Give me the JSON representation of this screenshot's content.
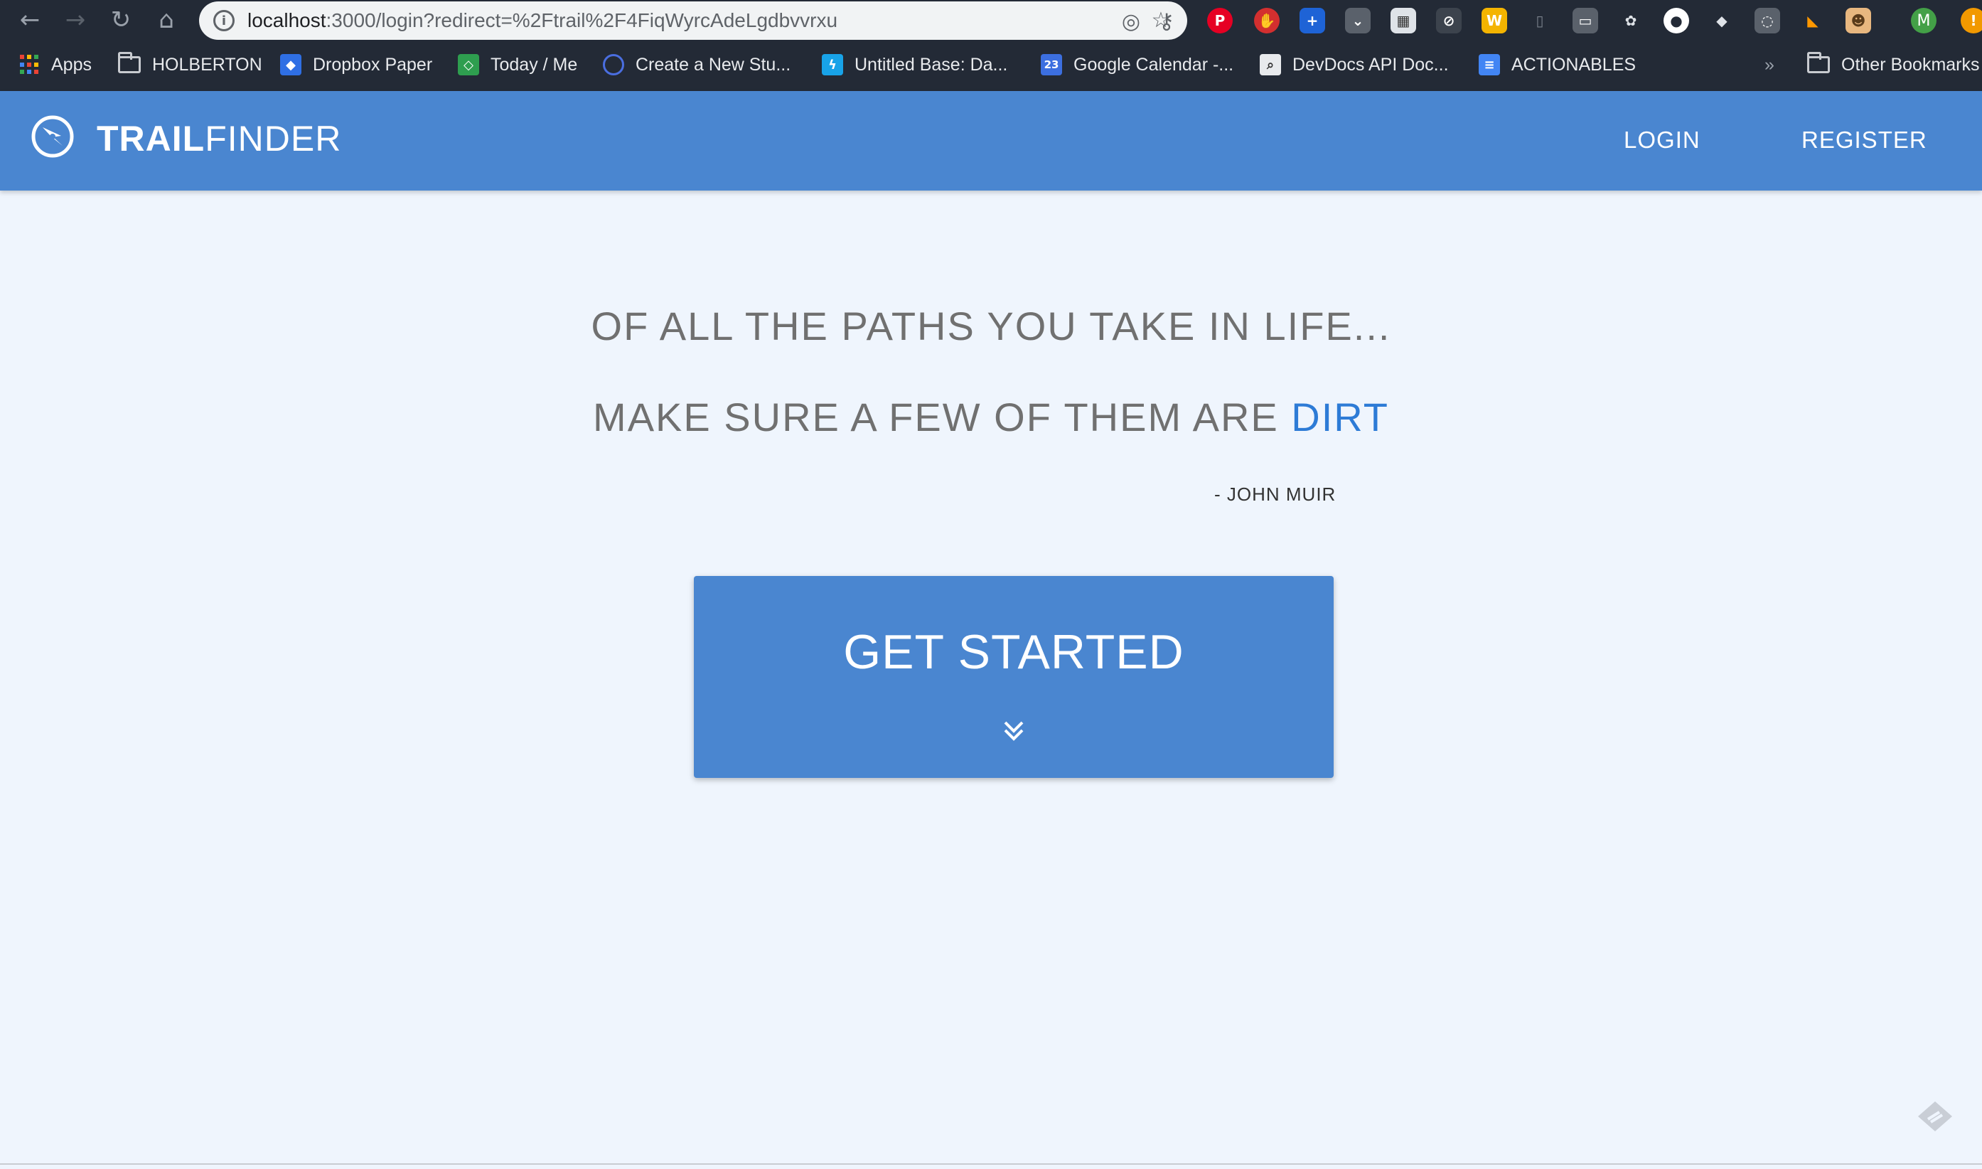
{
  "browser": {
    "url_host": "localhost",
    "url_rest": ":3000/login?redirect=%2Ftrail%2F4FiqWyrcAdeLgdbvvrxu",
    "avatar_letter": "M",
    "overflow_chevron": "»",
    "bookmarks": [
      {
        "label": "Apps",
        "icon": "apps-grid-icon"
      },
      {
        "label": "HOLBERTON",
        "icon": "folder-icon"
      },
      {
        "label": "Dropbox Paper",
        "icon": "dropbox-icon"
      },
      {
        "label": "Today / Me",
        "icon": "today-me-icon"
      },
      {
        "label": "Create a New Stu...",
        "icon": "create-icon"
      },
      {
        "label": "Untitled Base: Da...",
        "icon": "base-icon"
      },
      {
        "label": "Google Calendar -...",
        "icon": "calendar-icon",
        "icon_text": "23"
      },
      {
        "label": "DevDocs API Doc...",
        "icon": "devdocs-icon"
      },
      {
        "label": "ACTIONABLES",
        "icon": "docs-icon"
      }
    ],
    "other_bookmarks": "Other Bookmarks"
  },
  "app": {
    "brand_bold": "TRAIL",
    "brand_light": "FINDER",
    "nav": {
      "login": "LOGIN",
      "register": "REGISTER"
    }
  },
  "hero": {
    "line1": "OF ALL THE PATHS YOU TAKE IN LIFE...",
    "line2_prefix": "MAKE SURE A FEW OF THEM ARE ",
    "line2_accent": "DIRT",
    "author": "- JOHN MUIR",
    "cta_label": "GET STARTED"
  },
  "colors": {
    "header": "#4a86d0",
    "accent": "#2d7bd6",
    "background": "#eff5fd",
    "chrome": "#232a36"
  }
}
